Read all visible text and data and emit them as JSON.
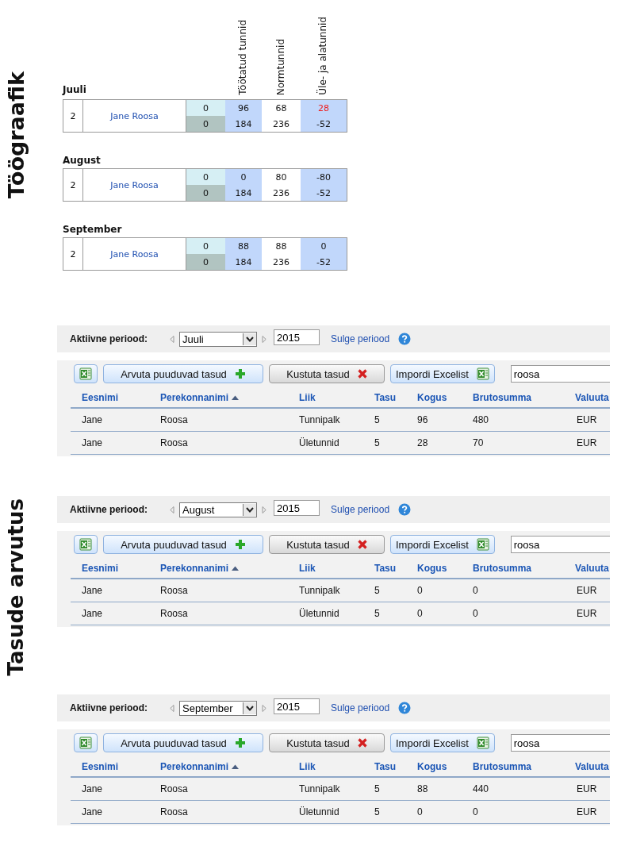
{
  "side_labels": [
    "Töögraafik",
    "Tasude arvutus"
  ],
  "schedule": {
    "headers": [
      "Töötatud tunnid",
      "Normtunnid",
      "Üle- ja alatunnid"
    ],
    "months": [
      {
        "name": "Juuli",
        "number": "2",
        "person": "Jane Roosa",
        "rows": [
          [
            {
              "value": "0",
              "alert": false
            },
            {
              "value": "96",
              "alert": false
            },
            {
              "value": "68",
              "alert": false
            },
            {
              "value": "28",
              "alert": true
            }
          ],
          [
            {
              "value": "0",
              "alert": false
            },
            {
              "value": "184",
              "alert": false
            },
            {
              "value": "236",
              "alert": false
            },
            {
              "value": "-52",
              "alert": false
            }
          ]
        ]
      },
      {
        "name": "August",
        "number": "2",
        "person": "Jane Roosa",
        "rows": [
          [
            {
              "value": "0",
              "alert": false
            },
            {
              "value": "0",
              "alert": false
            },
            {
              "value": "80",
              "alert": false
            },
            {
              "value": "-80",
              "alert": false
            }
          ],
          [
            {
              "value": "0",
              "alert": false
            },
            {
              "value": "184",
              "alert": false
            },
            {
              "value": "236",
              "alert": false
            },
            {
              "value": "-52",
              "alert": false
            }
          ]
        ]
      },
      {
        "name": "September",
        "number": "2",
        "person": "Jane Roosa",
        "rows": [
          [
            {
              "value": "0",
              "alert": false
            },
            {
              "value": "88",
              "alert": false
            },
            {
              "value": "88",
              "alert": false
            },
            {
              "value": "0",
              "alert": false
            }
          ],
          [
            {
              "value": "0",
              "alert": false
            },
            {
              "value": "184",
              "alert": false
            },
            {
              "value": "236",
              "alert": false
            },
            {
              "value": "-52",
              "alert": false
            }
          ]
        ]
      }
    ]
  },
  "payroll": [
    {
      "period": {
        "label": "Aktiivne periood:",
        "month": "Juuli",
        "year": "2015",
        "close_link": "Sulge periood"
      },
      "buttons": [
        {
          "kind": "export"
        },
        {
          "kind": "add",
          "label": "Arvuta puuduvad tasud"
        },
        {
          "kind": "delete",
          "label": "Kustuta tasud"
        },
        {
          "kind": "import",
          "label": "Impordi Excelist"
        }
      ],
      "search": "roosa",
      "columns": [
        {
          "label": "Eesnimi",
          "sorted": false
        },
        {
          "label": "Perekonnanimi",
          "sorted": true
        },
        {
          "label": "Liik",
          "sorted": false
        },
        {
          "label": "Tasu",
          "sorted": false
        },
        {
          "label": "Kogus",
          "sorted": false
        },
        {
          "label": "Brutosumma",
          "sorted": false
        },
        {
          "label": "Valuuta",
          "sorted": false
        }
      ],
      "rows": [
        [
          "Jane",
          "Roosa",
          "Tunnipalk",
          "5",
          "96",
          "480",
          "EUR"
        ],
        [
          "Jane",
          "Roosa",
          "Ületunnid",
          "5",
          "28",
          "70",
          "EUR"
        ]
      ]
    },
    {
      "period": {
        "label": "Aktiivne periood:",
        "month": "August",
        "year": "2015",
        "close_link": "Sulge periood"
      },
      "buttons": [
        {
          "kind": "export"
        },
        {
          "kind": "add",
          "label": "Arvuta puuduvad tasud"
        },
        {
          "kind": "delete",
          "label": "Kustuta tasud"
        },
        {
          "kind": "import",
          "label": "Impordi Excelist"
        }
      ],
      "search": "roosa",
      "columns": [
        {
          "label": "Eesnimi",
          "sorted": false
        },
        {
          "label": "Perekonnanimi",
          "sorted": true
        },
        {
          "label": "Liik",
          "sorted": false
        },
        {
          "label": "Tasu",
          "sorted": false
        },
        {
          "label": "Kogus",
          "sorted": false
        },
        {
          "label": "Brutosumma",
          "sorted": false
        },
        {
          "label": "Valuuta",
          "sorted": false
        }
      ],
      "rows": [
        [
          "Jane",
          "Roosa",
          "Tunnipalk",
          "5",
          "0",
          "0",
          "EUR"
        ],
        [
          "Jane",
          "Roosa",
          "Ületunnid",
          "5",
          "0",
          "0",
          "EUR"
        ]
      ]
    },
    {
      "period": {
        "label": "Aktiivne periood:",
        "month": "September",
        "year": "2015",
        "close_link": "Sulge periood"
      },
      "buttons": [
        {
          "kind": "export"
        },
        {
          "kind": "add",
          "label": "Arvuta puuduvad tasud"
        },
        {
          "kind": "delete",
          "label": "Kustuta tasud"
        },
        {
          "kind": "import",
          "label": "Impordi Excelist"
        }
      ],
      "search": "roosa",
      "columns": [
        {
          "label": "Eesnimi",
          "sorted": false
        },
        {
          "label": "Perekonnanimi",
          "sorted": true
        },
        {
          "label": "Liik",
          "sorted": false
        },
        {
          "label": "Tasu",
          "sorted": false
        },
        {
          "label": "Kogus",
          "sorted": false
        },
        {
          "label": "Brutosumma",
          "sorted": false
        },
        {
          "label": "Valuuta",
          "sorted": false
        }
      ],
      "rows": [
        [
          "Jane",
          "Roosa",
          "Tunnipalk",
          "5",
          "88",
          "440",
          "EUR"
        ],
        [
          "Jane",
          "Roosa",
          "Ületunnid",
          "5",
          "0",
          "0",
          "EUR"
        ]
      ]
    }
  ]
}
